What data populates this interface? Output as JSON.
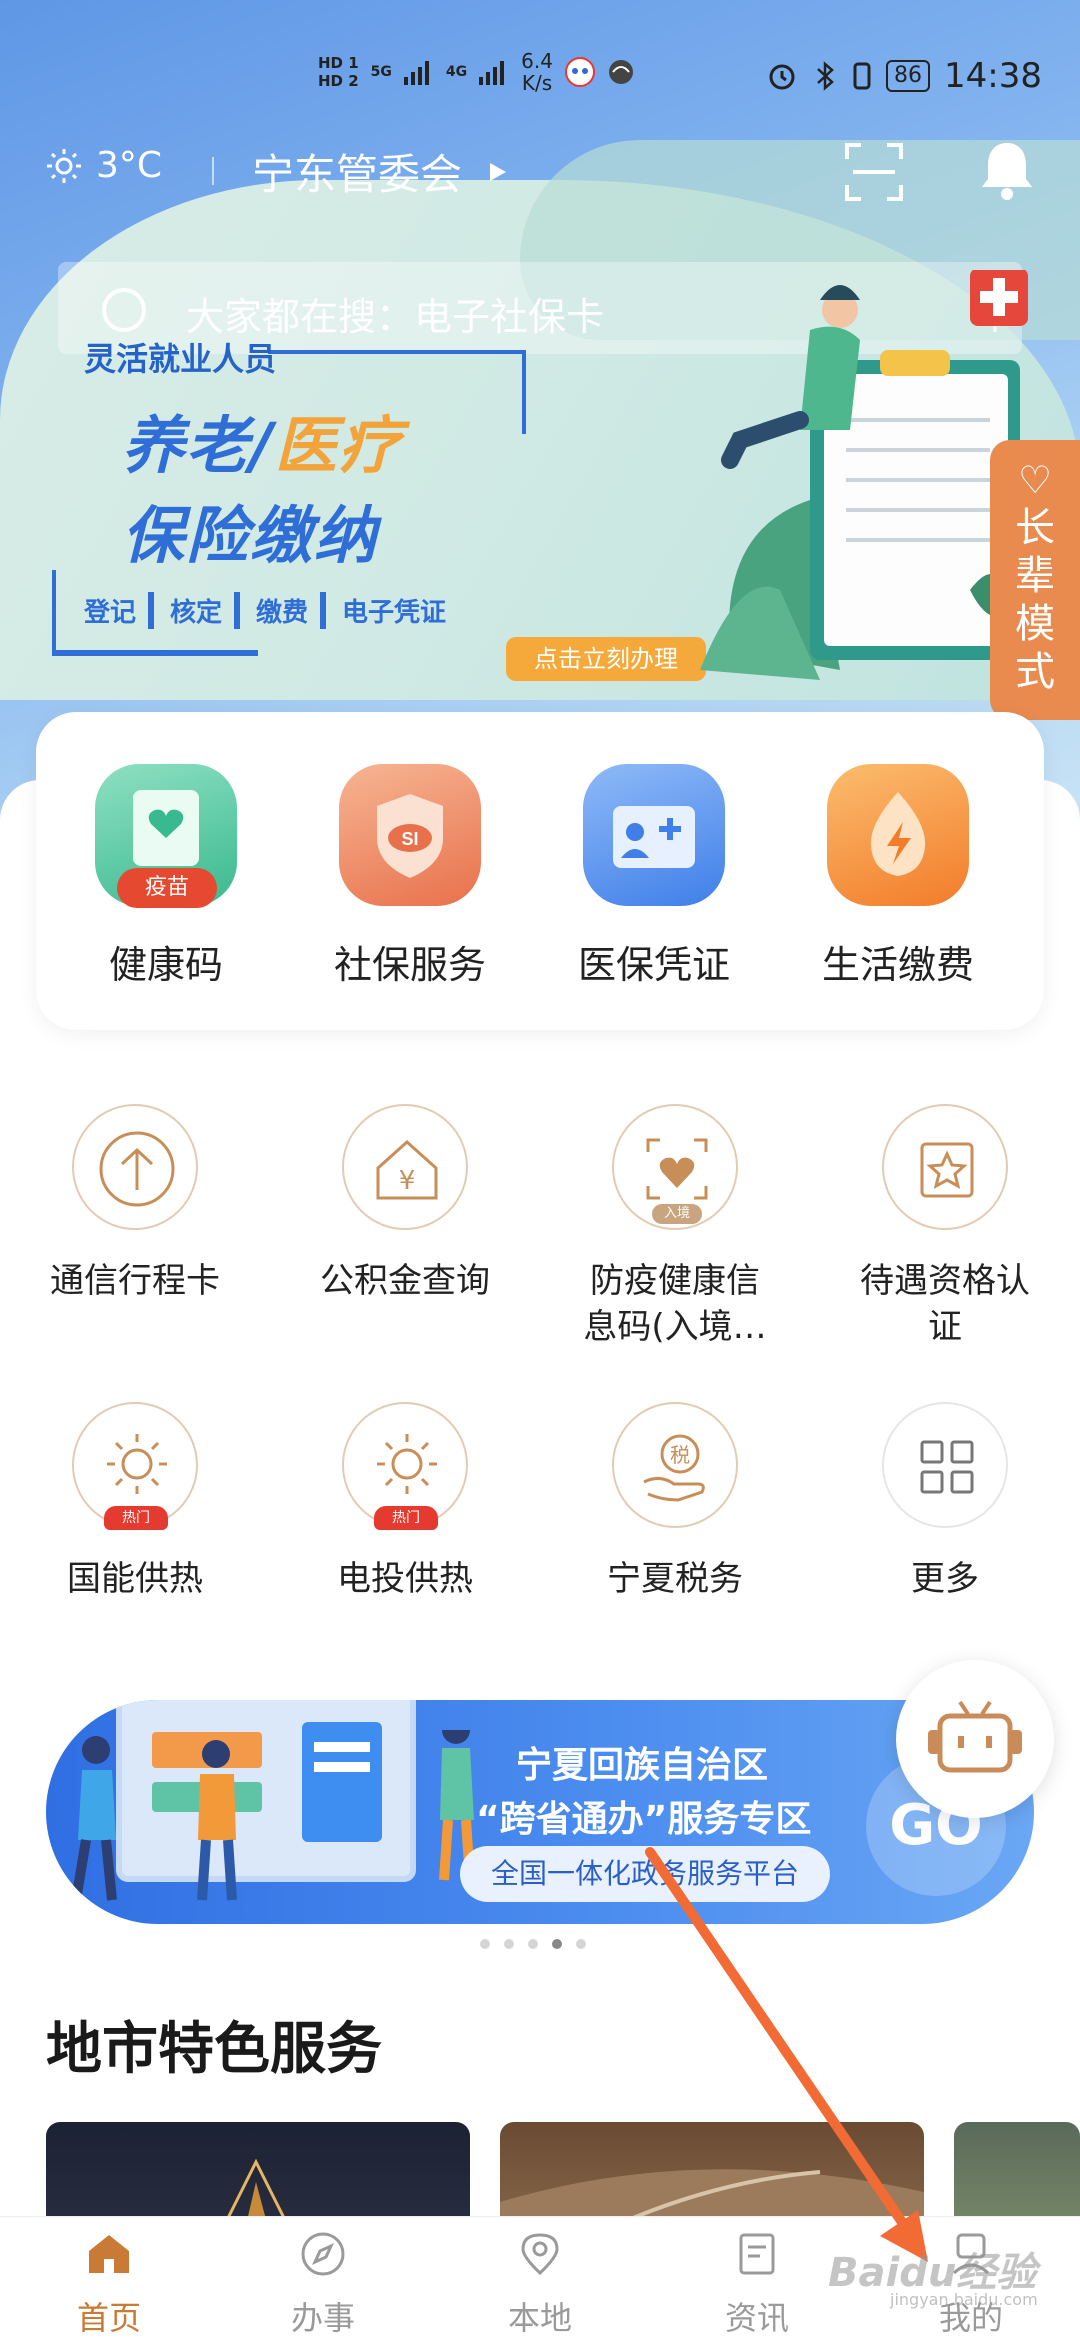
{
  "status_bar": {
    "hd1": "HD 1",
    "hd2": "HD 2",
    "net1": "5G",
    "net2": "4G",
    "speed_value": "6.4",
    "speed_unit": "K/s",
    "battery": "86",
    "time": "14:38"
  },
  "header": {
    "temperature": "3°C",
    "location": "宁东管委会"
  },
  "search": {
    "placeholder": "大家都在搜：电子社保卡"
  },
  "hero_banner": {
    "tag": "灵活就业人员",
    "line1_a": "养老/",
    "line1_b": "医疗",
    "line2": "保险缴纳",
    "steps": [
      "登记",
      "核定",
      "缴费",
      "电子凭证"
    ],
    "cta": "点击立刻办理"
  },
  "elder_mode": {
    "label": "长辈模式"
  },
  "quick_services": [
    {
      "label": "健康码",
      "badge": "疫苗",
      "color": "#4fc7a3"
    },
    {
      "label": "社保服务",
      "color": "#ef8a5a"
    },
    {
      "label": "医保凭证",
      "color": "#4a8ef0"
    },
    {
      "label": "生活缴费",
      "color": "#f4942f"
    }
  ],
  "services": [
    {
      "label": "通信行程卡"
    },
    {
      "label": "公积金查询"
    },
    {
      "label": "防疫健康信\n息码(入境…",
      "badge": "入境"
    },
    {
      "label": "待遇资格认\n证"
    },
    {
      "label": "国能供热",
      "badge": "热门"
    },
    {
      "label": "电投供热",
      "badge": "热门"
    },
    {
      "label": "宁夏税务",
      "icon_text": "税"
    },
    {
      "label": "更多"
    }
  ],
  "promo": {
    "title1": "宁夏回族自治区",
    "title2": "“跨省通办”服务专区",
    "pill": "全国一体化政务服务平台",
    "go": "GO"
  },
  "section": {
    "title": "地市特色服务"
  },
  "bottom_nav": [
    {
      "label": "首页",
      "icon": "home-icon",
      "active": true
    },
    {
      "label": "办事",
      "icon": "compass-icon"
    },
    {
      "label": "本地",
      "icon": "location-icon"
    },
    {
      "label": "资讯",
      "icon": "news-icon"
    },
    {
      "label": "我的",
      "icon": "profile-icon"
    }
  ],
  "watermark": {
    "text": "Baidu经验",
    "sub": "jingyan.baidu.com"
  },
  "colors": {
    "accent": "#c97b35",
    "arrow": "#f26b35"
  }
}
